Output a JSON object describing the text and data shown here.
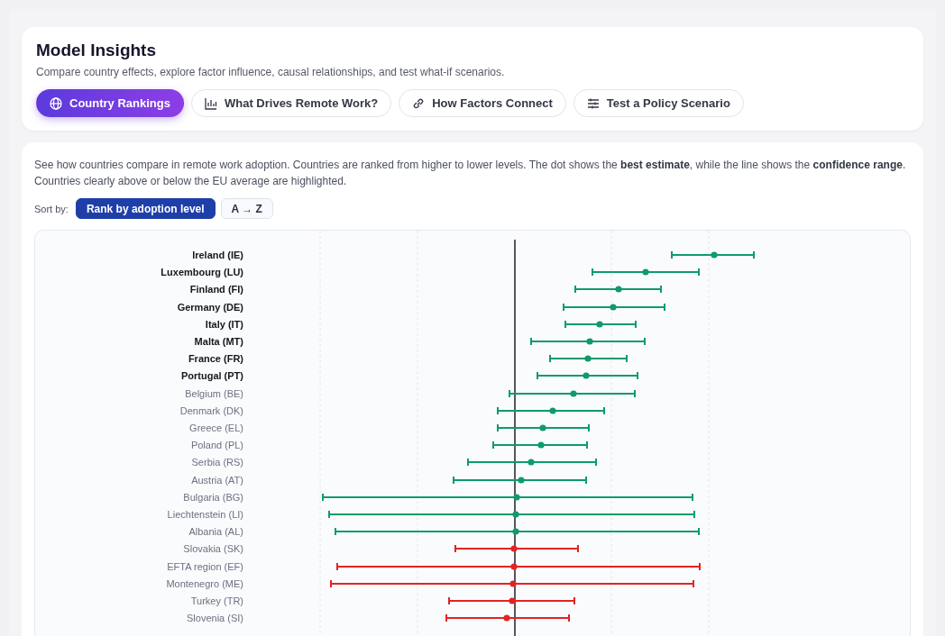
{
  "header": {
    "title": "Model Insights",
    "subtitle": "Compare country effects, explore factor influence, causal relationships, and test what-if scenarios."
  },
  "tabs": [
    {
      "label": "Country Rankings",
      "selected": true
    },
    {
      "label": "What Drives Remote Work?",
      "selected": false
    },
    {
      "label": "How Factors Connect",
      "selected": false
    },
    {
      "label": "Test a Policy Scenario",
      "selected": false
    }
  ],
  "rankings": {
    "description": "See how countries compare in remote work adoption. Countries are ranked from higher to lower levels. The dot shows the **best estimate**, while the line shows the **confidence range**. Countries clearly above or below the EU average are highlighted.",
    "sort_label": "Sort by:",
    "sort_options": [
      {
        "label": "Rank by adoption level",
        "selected": true
      },
      {
        "label": "A → Z",
        "selected": false
      }
    ],
    "countries": [
      {
        "label": "Ireland (IE)",
        "highlighted": true,
        "color": "#0f9a6c"
      },
      {
        "label": "Luxembourg (LU)",
        "highlighted": true,
        "color": "#0f9a6c"
      },
      {
        "label": "Finland (FI)",
        "highlighted": true,
        "color": "#0f9a6c"
      },
      {
        "label": "Germany (DE)",
        "highlighted": true,
        "color": "#0f9a6c"
      },
      {
        "label": "Italy (IT)",
        "highlighted": true,
        "color": "#0f9a6c"
      },
      {
        "label": "Malta (MT)",
        "highlighted": true,
        "color": "#0f9a6c"
      },
      {
        "label": "France (FR)",
        "highlighted": true,
        "color": "#0f9a6c"
      },
      {
        "label": "Portugal (PT)",
        "highlighted": true,
        "color": "#0f9a6c"
      },
      {
        "label": "Belgium (BE)",
        "highlighted": false,
        "color": "#0f9a6c"
      },
      {
        "label": "Denmark (DK)",
        "highlighted": false,
        "color": "#0f9a6c"
      },
      {
        "label": "Greece (EL)",
        "highlighted": false,
        "color": "#0f9a6c"
      },
      {
        "label": "Poland (PL)",
        "highlighted": false,
        "color": "#0f9a6c"
      },
      {
        "label": "Serbia (RS)",
        "highlighted": false,
        "color": "#0f9a6c"
      },
      {
        "label": "Austria (AT)",
        "highlighted": false,
        "color": "#0f9a6c"
      },
      {
        "label": "Bulgaria (BG)",
        "highlighted": false,
        "color": "#0f9a6c"
      },
      {
        "label": "Liechtenstein (LI)",
        "highlighted": false,
        "color": "#0f9a6c"
      },
      {
        "label": "Albania (AL)",
        "highlighted": false,
        "color": "#0f9a6c"
      },
      {
        "label": "Slovakia (SK)",
        "highlighted": false,
        "color": "#e02424"
      },
      {
        "label": "EFTA region (EF)",
        "highlighted": false,
        "color": "#e02424"
      },
      {
        "label": "Montenegro (ME)",
        "highlighted": false,
        "color": "#e02424"
      },
      {
        "label": "Turkey (TR)",
        "highlighted": false,
        "color": "#e02424"
      },
      {
        "label": "Slovenia (SI)",
        "highlighted": false,
        "color": "#e02424"
      }
    ]
  }
}
